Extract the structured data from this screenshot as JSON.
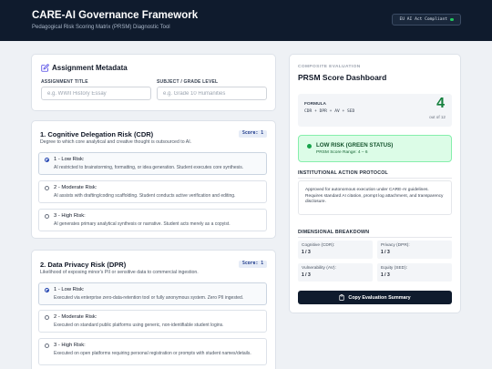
{
  "header": {
    "title": "CARE-AI Governance Framework",
    "subtitle": "Pedagogical Risk Scoring Matrix (PRSM) Diagnostic Tool",
    "badge": "EU AI Act Compliant"
  },
  "metadata": {
    "title": "Assignment Metadata",
    "assignment_label": "ASSIGNMENT TITLE",
    "assignment_placeholder": "e.g. WWII History Essay",
    "subject_label": "SUBJECT / GRADE LEVEL",
    "subject_placeholder": "e.g. Grade 10 Humanities"
  },
  "sections": [
    {
      "title": "1. Cognitive Delegation Risk (CDR)",
      "description": "Degree to which core analytical and creative thought is outsourced to AI.",
      "score": "Score: 1",
      "options": [
        {
          "title": "1 - Low Risk:",
          "desc": "AI restricted to brainstorming, formatting, or idea generation. Student executes core synthesis.",
          "selected": true
        },
        {
          "title": "2 - Moderate Risk:",
          "desc": "AI assists with drafting/coding scaffolding. Student conducts active verification and editing.",
          "selected": false
        },
        {
          "title": "3 - High Risk:",
          "desc": "AI generates primary analytical synthesis or narrative. Student acts merely as a copyist.",
          "selected": false
        }
      ]
    },
    {
      "title": "2. Data Privacy Risk (DPR)",
      "description": "Likelihood of exposing minor's PII or sensitive data to commercial ingestion.",
      "score": "Score: 1",
      "options": [
        {
          "title": "1 - Low Risk:",
          "desc": "Executed via enterprise zero-data-retention tool or fully anonymous system. Zero PII ingested.",
          "selected": true
        },
        {
          "title": "2 - Moderate Risk:",
          "desc": "Executed on standard public platforms using generic, non-identifiable student logins.",
          "selected": false
        },
        {
          "title": "3 - High Risk:",
          "desc": "Executed on open platforms requiring personal registration or prompts with student names/details.",
          "selected": false
        }
      ]
    }
  ],
  "dashboard": {
    "caption": "COMPOSITE EVALUATION",
    "title": "PRSM Score Dashboard",
    "formula_label": "FORMULA",
    "formula": "CDR + DPR + AV + SED",
    "score": "4",
    "out_of": "out of 12",
    "risk_title": "LOW RISK (GREEN STATUS)",
    "risk_range": "PRSM Score Range: 4 – 6",
    "protocol_title": "INSTITUTIONAL ACTION PROTOCOL",
    "protocol_text": "Approved for autonomous execution under CARE-AI guidelines. Requires standard AI citation, prompt log attachment, and transparency disclosure.",
    "breakdown_title": "DIMENSIONAL BREAKDOWN",
    "dimensions": [
      {
        "label": "Cognitive (CDR):",
        "value": "1 / 3"
      },
      {
        "label": "Privacy (DPR):",
        "value": "1 / 3"
      },
      {
        "label": "Vulnerability (AV):",
        "value": "1 / 3"
      },
      {
        "label": "Equity (SED):",
        "value": "1 / 3"
      }
    ],
    "copy_button": "Copy Evaluation Summary"
  },
  "colors": {
    "header_bg": "#0f1b2d",
    "low_risk_green": "#16a34a",
    "accent_blue": "#1e40af"
  }
}
